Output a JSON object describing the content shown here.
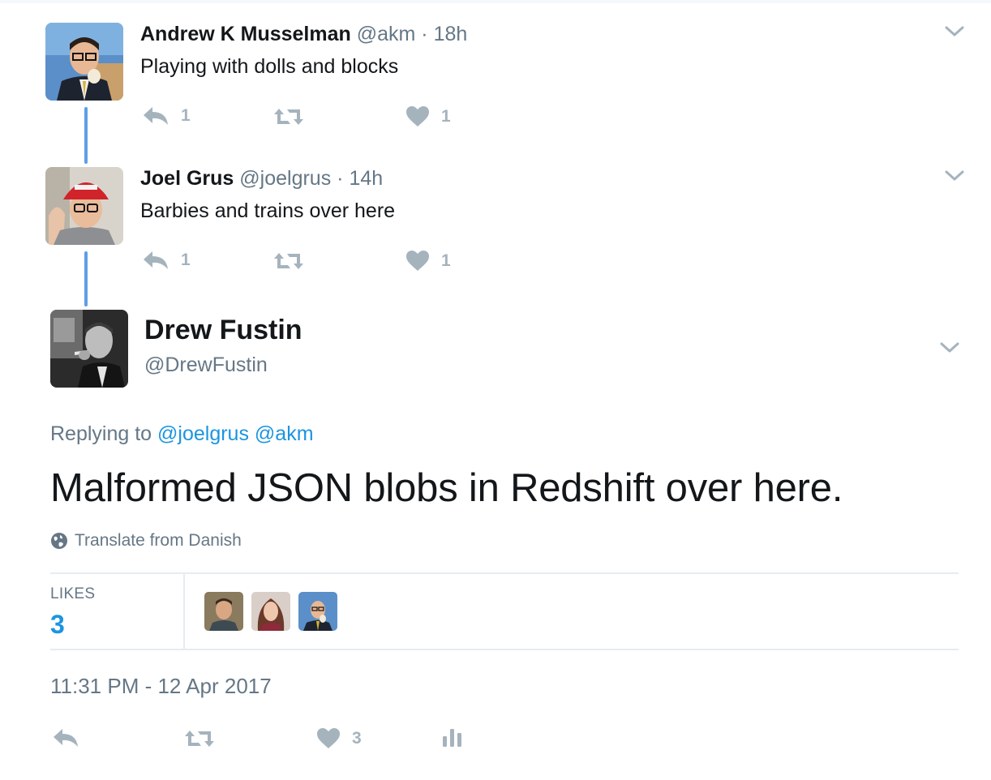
{
  "colors": {
    "accent": "#1b95e0",
    "muted": "#657786",
    "icon": "#a5b3bd",
    "thread_line": "#5e9fe7"
  },
  "replies": [
    {
      "name": "Andrew K Musselman",
      "handle": "@akm",
      "dot": "·",
      "time": "18h",
      "text": "Playing with dolls and blocks",
      "reply_count": "1",
      "like_count": "1"
    },
    {
      "name": "Joel Grus",
      "handle": "@joelgrus",
      "dot": "·",
      "time": "14h",
      "text": "Barbies and trains over here",
      "reply_count": "1",
      "like_count": "1"
    }
  ],
  "main": {
    "name": "Drew Fustin",
    "handle": "@DrewFustin",
    "replying_prefix": "Replying to",
    "reply_to": [
      "@joelgrus",
      "@akm"
    ],
    "text": "Malformed JSON blobs in Redshift over here.",
    "translate": "Translate from Danish",
    "likes_label": "LIKES",
    "likes_count": "3",
    "timestamp": "11:31 PM - 12 Apr 2017",
    "like_count": "3"
  },
  "icons": {
    "reply": "reply-icon",
    "retweet": "retweet-icon",
    "like": "heart-icon",
    "analytics": "analytics-icon",
    "more": "chevron-down-icon",
    "globe": "globe-icon"
  }
}
